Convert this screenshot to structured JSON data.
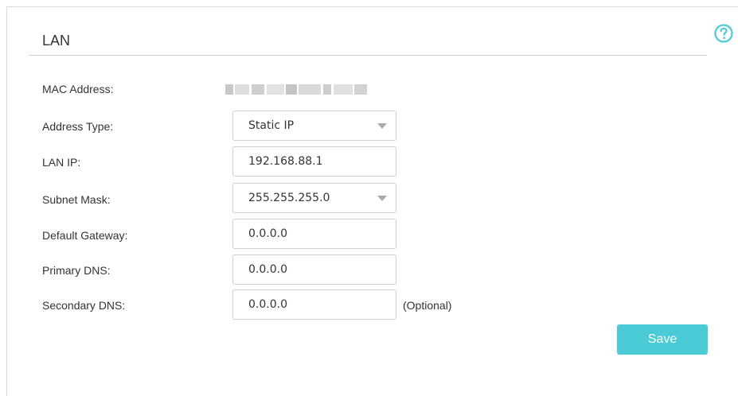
{
  "section": {
    "title": "LAN"
  },
  "help": {
    "icon": "help-circle-icon",
    "color": "#4acbd6"
  },
  "form": {
    "mac_address": {
      "label": "MAC Address:"
    },
    "address_type": {
      "label": "Address Type:",
      "value": "Static IP"
    },
    "lan_ip": {
      "label": "LAN IP:",
      "value": "192.168.88.1"
    },
    "subnet_mask": {
      "label": "Subnet Mask:",
      "value": "255.255.255.0"
    },
    "default_gateway": {
      "label": "Default Gateway:",
      "value": "0.0.0.0"
    },
    "primary_dns": {
      "label": "Primary DNS:",
      "value": "0.0.0.0"
    },
    "secondary_dns": {
      "label": "Secondary DNS:",
      "value": "0.0.0.0",
      "note": "(Optional)"
    }
  },
  "actions": {
    "save_label": "Save",
    "save_color": "#4acbd6"
  }
}
